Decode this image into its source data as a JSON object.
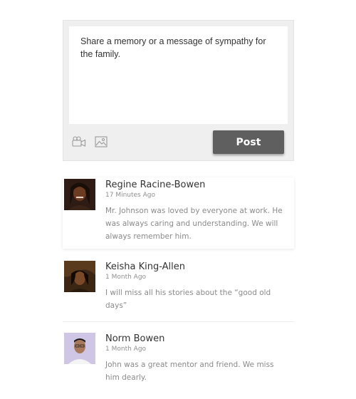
{
  "composer": {
    "placeholder": "Share a memory or a message of sympathy for the family.",
    "tools": [
      {
        "icon": "video-camera-icon"
      },
      {
        "icon": "image-icon"
      }
    ],
    "post_label": "Post",
    "post_button_color": "#5f5f5f"
  },
  "comments": [
    {
      "author": "Regine Racine-Bowen",
      "time": "17 Minutes Ago",
      "message": "Mr. Johnson was loved by everyone at work. He was always caring and understanding. We will always remember him."
    },
    {
      "author": "Keisha King-Allen",
      "time": "1 Month Ago",
      "message": "I will miss all his stories about the “good old days”"
    },
    {
      "author": "Norm Bowen",
      "time": "1 Month Ago",
      "message": "John was a great mentor and friend. We miss him dearly."
    }
  ],
  "colors": {
    "panel": "#efefef",
    "author_text": "#333333",
    "meta_text": "#8f8f8f"
  }
}
